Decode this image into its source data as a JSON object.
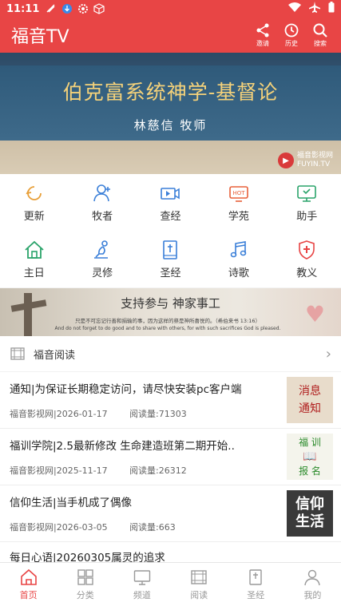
{
  "status_bar": {
    "time": "11:11"
  },
  "header": {
    "title": "福音TV",
    "actions": [
      {
        "label": "邀请",
        "icon": "share-icon"
      },
      {
        "label": "历史",
        "icon": "history-icon"
      },
      {
        "label": "搜索",
        "icon": "search-icon"
      }
    ]
  },
  "banner": {
    "title": "伯克富系统神学-基督论",
    "subtitle": "林慈信 牧师",
    "watermark_cn": "福音影视网",
    "watermark_en": "FUYIN.TV"
  },
  "grid": {
    "items": [
      {
        "label": "更新",
        "icon": "refresh-icon",
        "color": "#e8a03a"
      },
      {
        "label": "牧者",
        "icon": "person-add-icon",
        "color": "#3a7fd8"
      },
      {
        "label": "查经",
        "icon": "video-icon",
        "color": "#3a7fd8"
      },
      {
        "label": "学苑",
        "icon": "hot-icon",
        "color": "#e8603a"
      },
      {
        "label": "助手",
        "icon": "monitor-icon",
        "color": "#2aa36a"
      },
      {
        "label": "主日",
        "icon": "home-icon",
        "color": "#2aa36a"
      },
      {
        "label": "灵修",
        "icon": "prayer-icon",
        "color": "#3a7fd8"
      },
      {
        "label": "圣经",
        "icon": "bible-icon",
        "color": "#3a7fd8"
      },
      {
        "label": "诗歌",
        "icon": "music-icon",
        "color": "#3a7fd8"
      },
      {
        "label": "教义",
        "icon": "shield-icon",
        "color": "#e84545"
      }
    ]
  },
  "promo": {
    "title": "支持参与 神家事工",
    "line1": "只是不可忘记行善和捐输的事，因为这样的祭是神所喜悦的。（希伯来书 13:16）",
    "line2": "And do not forget to do good and to share with others, for with such sacrifices God is pleased."
  },
  "section": {
    "title": "福音阅读"
  },
  "news": [
    {
      "title": "通知|为保证长期稳定访问，请尽快安装pc客户端",
      "source": "福音影视网|2026-01-17",
      "reads": "阅读量:71303",
      "thumb_lines": [
        "消息",
        "通知"
      ]
    },
    {
      "title": "福训学院|2.5最新修改 生命建造班第二期开始..",
      "source": "福音影视网|2025-11-17",
      "reads": "阅读量:26312",
      "thumb_lines": [
        "福 训",
        "报 名"
      ]
    },
    {
      "title": "信仰生活|当手机成了偶像",
      "source": "福音影视网|2026-03-05",
      "reads": "阅读量:663",
      "thumb_lines": [
        "信仰",
        "生活"
      ]
    },
    {
      "title": "每日心语|20260305属灵的追求"
    }
  ],
  "bottom_nav": [
    {
      "label": "首页",
      "icon": "home-icon",
      "active": true
    },
    {
      "label": "分类",
      "icon": "grid-icon"
    },
    {
      "label": "频道",
      "icon": "tv-icon"
    },
    {
      "label": "阅读",
      "icon": "book-icon"
    },
    {
      "label": "圣经",
      "icon": "bible-icon"
    },
    {
      "label": "我的",
      "icon": "user-icon"
    }
  ],
  "colors": {
    "brand": "#e84545"
  }
}
